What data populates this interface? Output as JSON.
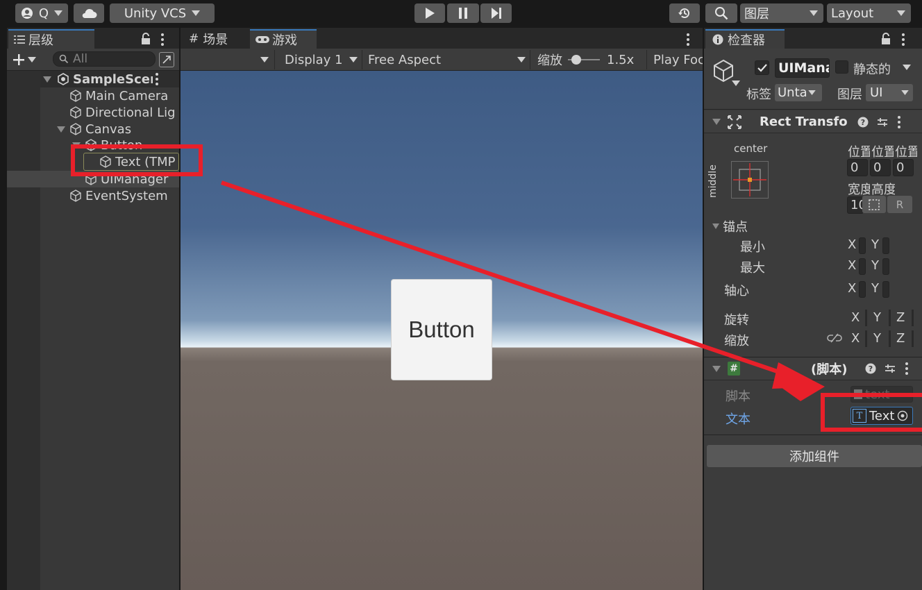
{
  "toolbar": {
    "account_label": "Q",
    "vcs_label": "Unity VCS",
    "layers_label": "图层",
    "layout_label": "Layout",
    "icons": [
      "account-icon",
      "cloud-icon",
      "play-icon",
      "pause-icon",
      "step-icon",
      "history-icon",
      "search-icon"
    ]
  },
  "hierarchy": {
    "tab_label": "层级",
    "search_placeholder": "All",
    "scene_name": "SampleScene",
    "items": [
      {
        "label": "Main Camera"
      },
      {
        "label": "Directional Lig"
      },
      {
        "label": "Canvas"
      },
      {
        "label": "Button"
      },
      {
        "label": "Text (TMP"
      },
      {
        "label": "UIManager"
      },
      {
        "label": "EventSystem"
      }
    ]
  },
  "center": {
    "scene_tab": "场景",
    "game_tab": "游戏",
    "display": "Display 1",
    "aspect": "Free Aspect",
    "scale_label": "缩放",
    "scale_value": 0.15,
    "scale_text": "1.5x",
    "play_focus": "Play Foc",
    "game_button_text": "Button"
  },
  "inspector": {
    "tab_label": "检查器",
    "object_name": "UIMana",
    "static_label": "静态的",
    "tag_label": "标签",
    "tag_value": "Unta",
    "layer_label": "图层",
    "layer_value": "UI",
    "rect_title": "Rect Transfo",
    "anchor_h": "center",
    "anchor_v": "middle",
    "pos_labels": [
      "位置",
      "位置",
      "位置"
    ],
    "pos_values": [
      "0",
      "0",
      "0"
    ],
    "width_label": "宽度",
    "height_label": "高度",
    "width_value": "10",
    "r_label": "R",
    "anchors_label": "锚点",
    "min_label": "最小",
    "max_label": "最大",
    "pivot_label": "轴心",
    "rotation_label": "旋转",
    "scale_label": "缩放",
    "x": "X",
    "y": "Y",
    "z": "Z",
    "script_header": "(脚本)",
    "script_label": "脚本",
    "script_value": "text",
    "text_label": "文本",
    "text_value": "Text",
    "add_component": "添加组件"
  },
  "colors": {
    "accent": "#3a79bb",
    "highlight_red": "#e8202a",
    "sky_top": "#3e5b84",
    "ground": "#675c57"
  }
}
